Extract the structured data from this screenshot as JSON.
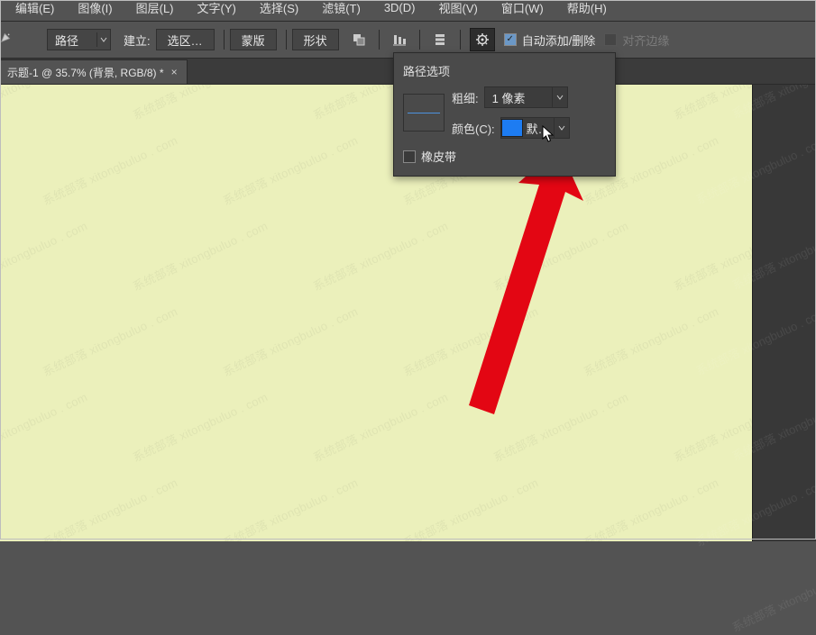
{
  "menu": {
    "edit": "编辑(E)",
    "image": "图像(I)",
    "layer": "图层(L)",
    "type": "文字(Y)",
    "select": "选择(S)",
    "filter": "滤镜(T)",
    "threeD": "3D(D)",
    "view": "视图(V)",
    "window": "窗口(W)",
    "help": "帮助(H)"
  },
  "options": {
    "mode_combo": "路径",
    "create_label": "建立:",
    "btn_selection": "选区…",
    "btn_mask": "蒙版",
    "btn_shape": "形状",
    "auto_add_delete": "自动添加/删除",
    "align_edges": "对齐边缘"
  },
  "tab": {
    "title": "示题-1 @ 35.7% (背景, RGB/8) *"
  },
  "popup": {
    "title": "路径选项",
    "thickness_label": "粗细:",
    "thickness_value": "1 像素",
    "color_label": "颜色(C):",
    "color_value": "默…",
    "rubber_band": "橡皮带"
  },
  "colors": {
    "stroke_swatch": "#1d7cf2",
    "arrow": "#e30613"
  },
  "watermark_text": "系统部落 xitongbuluo . com"
}
